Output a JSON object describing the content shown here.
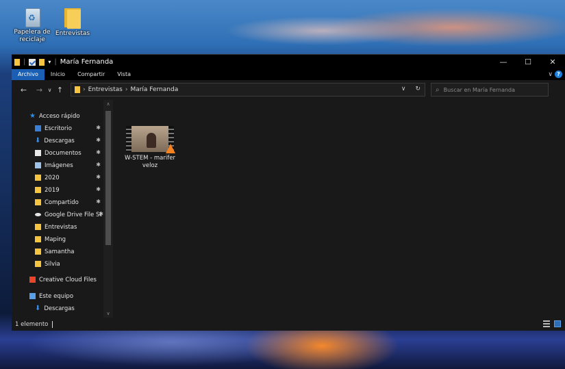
{
  "desktop": {
    "icons": [
      {
        "label": "Papelera de reciclaje"
      },
      {
        "label": "Entrevistas"
      }
    ]
  },
  "window": {
    "title": "María Fernanda",
    "controls": {
      "minimize": "—",
      "maximize": "☐",
      "close": "✕"
    }
  },
  "ribbon": {
    "tabs": [
      "Archivo",
      "Inicio",
      "Compartir",
      "Vista"
    ],
    "help": "?"
  },
  "address": {
    "crumbs": [
      "Entrevistas",
      "María Fernanda"
    ],
    "search_placeholder": "Buscar en María Fernanda"
  },
  "nav": {
    "items": [
      {
        "label": "Acceso rápido",
        "icon": "star-icon",
        "pinned": false
      },
      {
        "label": "Escritorio",
        "icon": "desktop-icon",
        "pinned": true
      },
      {
        "label": "Descargas",
        "icon": "download-icon",
        "pinned": true
      },
      {
        "label": "Documentos",
        "icon": "documents-icon",
        "pinned": true
      },
      {
        "label": "Imágenes",
        "icon": "pictures-icon",
        "pinned": true
      },
      {
        "label": "2020",
        "icon": "folder-icon",
        "pinned": true
      },
      {
        "label": "2019",
        "icon": "folder-icon",
        "pinned": true
      },
      {
        "label": "Compartido",
        "icon": "folder-icon",
        "pinned": true
      },
      {
        "label": "Google Drive File St",
        "icon": "cloud-icon",
        "pinned": true
      },
      {
        "label": "Entrevistas",
        "icon": "folder-icon",
        "pinned": false
      },
      {
        "label": "Maping",
        "icon": "folder-icon",
        "pinned": false
      },
      {
        "label": "Samantha",
        "icon": "folder-icon",
        "pinned": false
      },
      {
        "label": "Silvia",
        "icon": "folder-icon",
        "pinned": false
      },
      {
        "label": "Creative Cloud Files",
        "icon": "creative-cloud-icon",
        "pinned": false
      },
      {
        "label": "Este equipo",
        "icon": "computer-icon",
        "pinned": false
      },
      {
        "label": "Descargas",
        "icon": "download-icon",
        "pinned": false
      }
    ]
  },
  "content": {
    "files": [
      {
        "name": "W-STEM - marifer veloz",
        "icon": "vlc-video-icon"
      }
    ]
  },
  "status": {
    "count": "1 elemento"
  }
}
